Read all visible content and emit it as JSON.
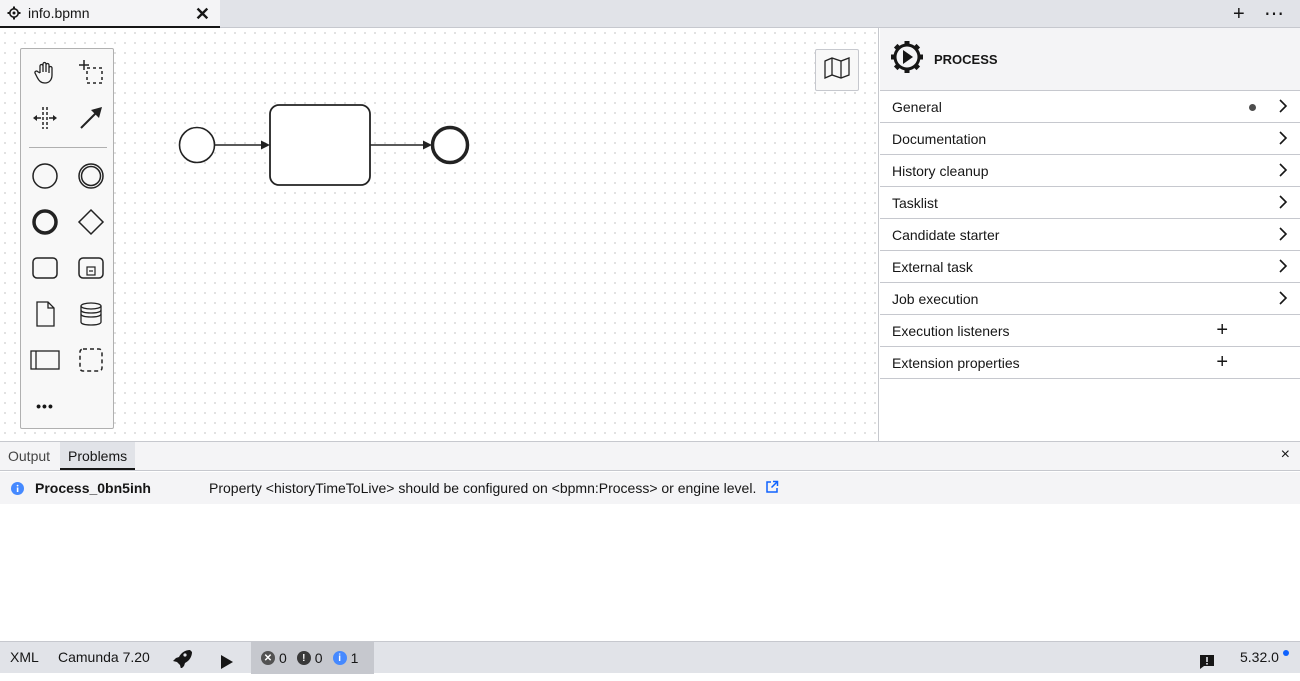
{
  "tab": {
    "title": "info.bpmn",
    "close": "✕"
  },
  "tabbar_actions": {
    "add": "+",
    "more": "⋯"
  },
  "palette": {
    "tools": [
      "hand-tool",
      "lasso-tool",
      "space-tool",
      "global-connect-tool"
    ],
    "elements": [
      "start-event",
      "intermediate-event",
      "end-event",
      "gateway",
      "task",
      "subprocess",
      "data-object",
      "data-store",
      "pool",
      "group"
    ],
    "more": "•••"
  },
  "properties": {
    "header_title": "PROCESS",
    "groups": [
      {
        "label": "General",
        "type": "chevron",
        "dot": true
      },
      {
        "label": "Documentation",
        "type": "chevron"
      },
      {
        "label": "History cleanup",
        "type": "chevron"
      },
      {
        "label": "Tasklist",
        "type": "chevron"
      },
      {
        "label": "Candidate starter",
        "type": "chevron"
      },
      {
        "label": "External task",
        "type": "chevron"
      },
      {
        "label": "Job execution",
        "type": "chevron"
      },
      {
        "label": "Execution listeners",
        "type": "plus"
      },
      {
        "label": "Extension properties",
        "type": "plus"
      }
    ]
  },
  "panel": {
    "tabs": [
      "Output",
      "Problems"
    ],
    "active_tab": "Problems",
    "close": "×",
    "problems": [
      {
        "severity": "info",
        "id": "Process_0bn5inh",
        "message": "Property <historyTimeToLive> should be configured on <bpmn:Process> or engine level."
      }
    ]
  },
  "statusbar": {
    "xml": "XML",
    "engine": "Camunda 7.20",
    "errors": "0",
    "warnings": "0",
    "infos": "1",
    "version": "5.32.0"
  },
  "colors": {
    "info": "#4589ff",
    "accent": "#0f62fe"
  }
}
